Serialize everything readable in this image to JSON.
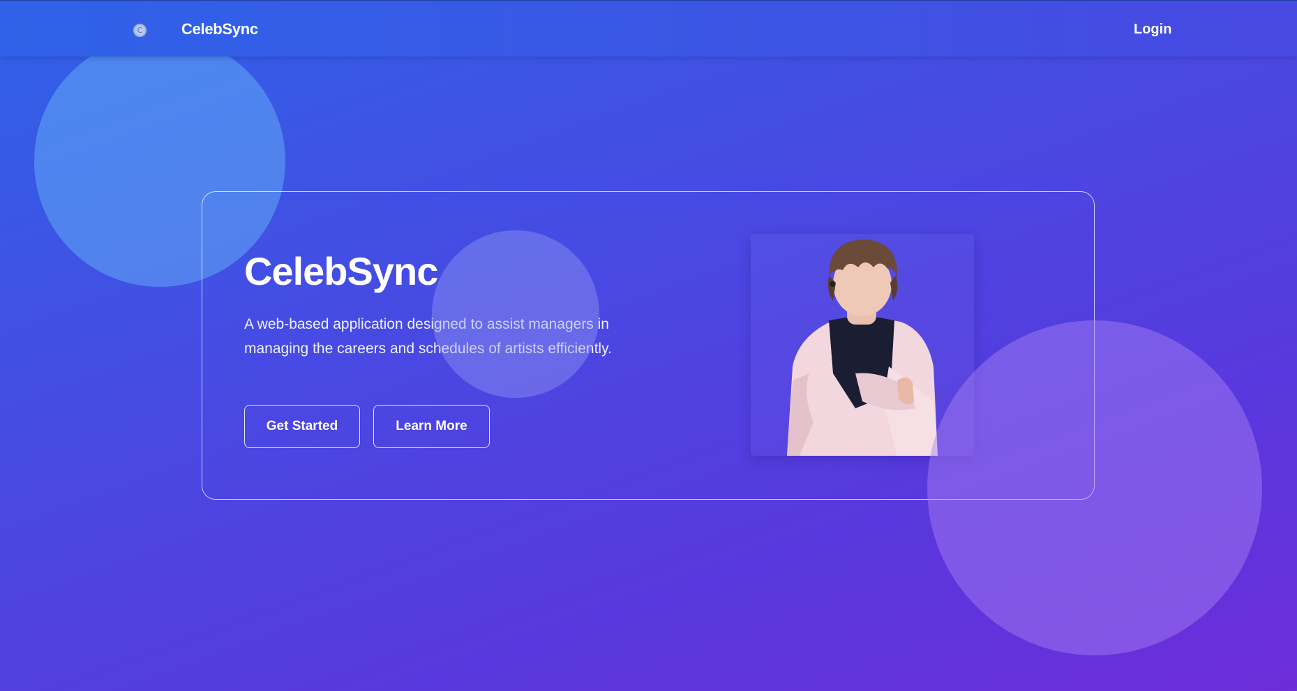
{
  "nav": {
    "logo_letter": "C",
    "brand": "CelebSync",
    "login_label": "Login"
  },
  "hero": {
    "title": "CelebSync",
    "description": "A web-based application designed to assist managers in managing the careers and schedules of artists efficiently.",
    "primary_button": "Get Started",
    "secondary_button": "Learn More"
  },
  "colors": {
    "gradient_start": "#2f62e8",
    "gradient_end": "#6d2dd9",
    "text": "#ffffff"
  }
}
